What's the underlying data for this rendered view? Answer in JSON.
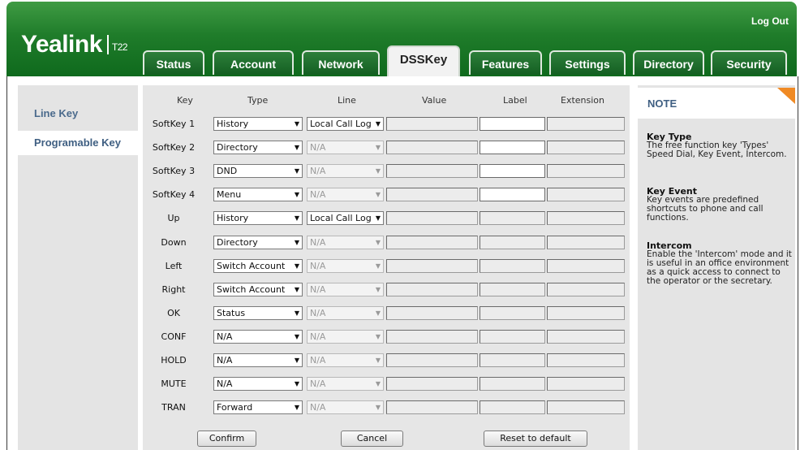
{
  "header": {
    "brand": "Yealink",
    "model": "T22",
    "logout": "Log Out"
  },
  "tabs": [
    "Status",
    "Account",
    "Network",
    "DSSKey",
    "Features",
    "Settings",
    "Directory",
    "Security"
  ],
  "active_tab": "DSSKey",
  "sidebar": {
    "items": [
      "Line Key",
      "Programable Key"
    ],
    "active": "Programable Key"
  },
  "table": {
    "columns": [
      "Key",
      "Type",
      "Line",
      "Value",
      "Label",
      "Extension"
    ],
    "rows": [
      {
        "key": "SoftKey 1",
        "type": "History",
        "line": "Local Call Log",
        "line_enabled": true,
        "label_enabled": true
      },
      {
        "key": "SoftKey 2",
        "type": "Directory",
        "line": "N/A",
        "line_enabled": false,
        "label_enabled": true
      },
      {
        "key": "SoftKey 3",
        "type": "DND",
        "line": "N/A",
        "line_enabled": false,
        "label_enabled": true
      },
      {
        "key": "SoftKey 4",
        "type": "Menu",
        "line": "N/A",
        "line_enabled": false,
        "label_enabled": true
      },
      {
        "key": "Up",
        "type": "History",
        "line": "Local Call Log",
        "line_enabled": true,
        "label_enabled": false
      },
      {
        "key": "Down",
        "type": "Directory",
        "line": "N/A",
        "line_enabled": false,
        "label_enabled": false
      },
      {
        "key": "Left",
        "type": "Switch Account",
        "line": "N/A",
        "line_enabled": false,
        "label_enabled": false
      },
      {
        "key": "Right",
        "type": "Switch Account",
        "line": "N/A",
        "line_enabled": false,
        "label_enabled": false
      },
      {
        "key": "OK",
        "type": "Status",
        "line": "N/A",
        "line_enabled": false,
        "label_enabled": false
      },
      {
        "key": "CONF",
        "type": "N/A",
        "line": "N/A",
        "line_enabled": false,
        "label_enabled": false
      },
      {
        "key": "HOLD",
        "type": "N/A",
        "line": "N/A",
        "line_enabled": false,
        "label_enabled": false
      },
      {
        "key": "MUTE",
        "type": "N/A",
        "line": "N/A",
        "line_enabled": false,
        "label_enabled": false
      },
      {
        "key": "TRAN",
        "type": "Forward",
        "line": "N/A",
        "line_enabled": false,
        "label_enabled": false
      }
    ]
  },
  "buttons": {
    "confirm": "Confirm",
    "cancel": "Cancel",
    "reset": "Reset to default"
  },
  "note": {
    "title": "NOTE",
    "sections": [
      {
        "heading": "Key Type",
        "text": "The free function key 'Types' Speed Dial, Key Event, Intercom."
      },
      {
        "heading": "Key Event",
        "text": "Key events are predefined shortcuts to phone and call functions."
      },
      {
        "heading": "Intercom",
        "text": "Enable the 'Intercom' mode and it is useful in an office environment as a quick access to connect to the operator or the secretary."
      }
    ]
  },
  "colors": {
    "header_green": "#1f7c2a",
    "note_corner": "#f08a24",
    "sidebar_text": "#4a6a8c"
  }
}
